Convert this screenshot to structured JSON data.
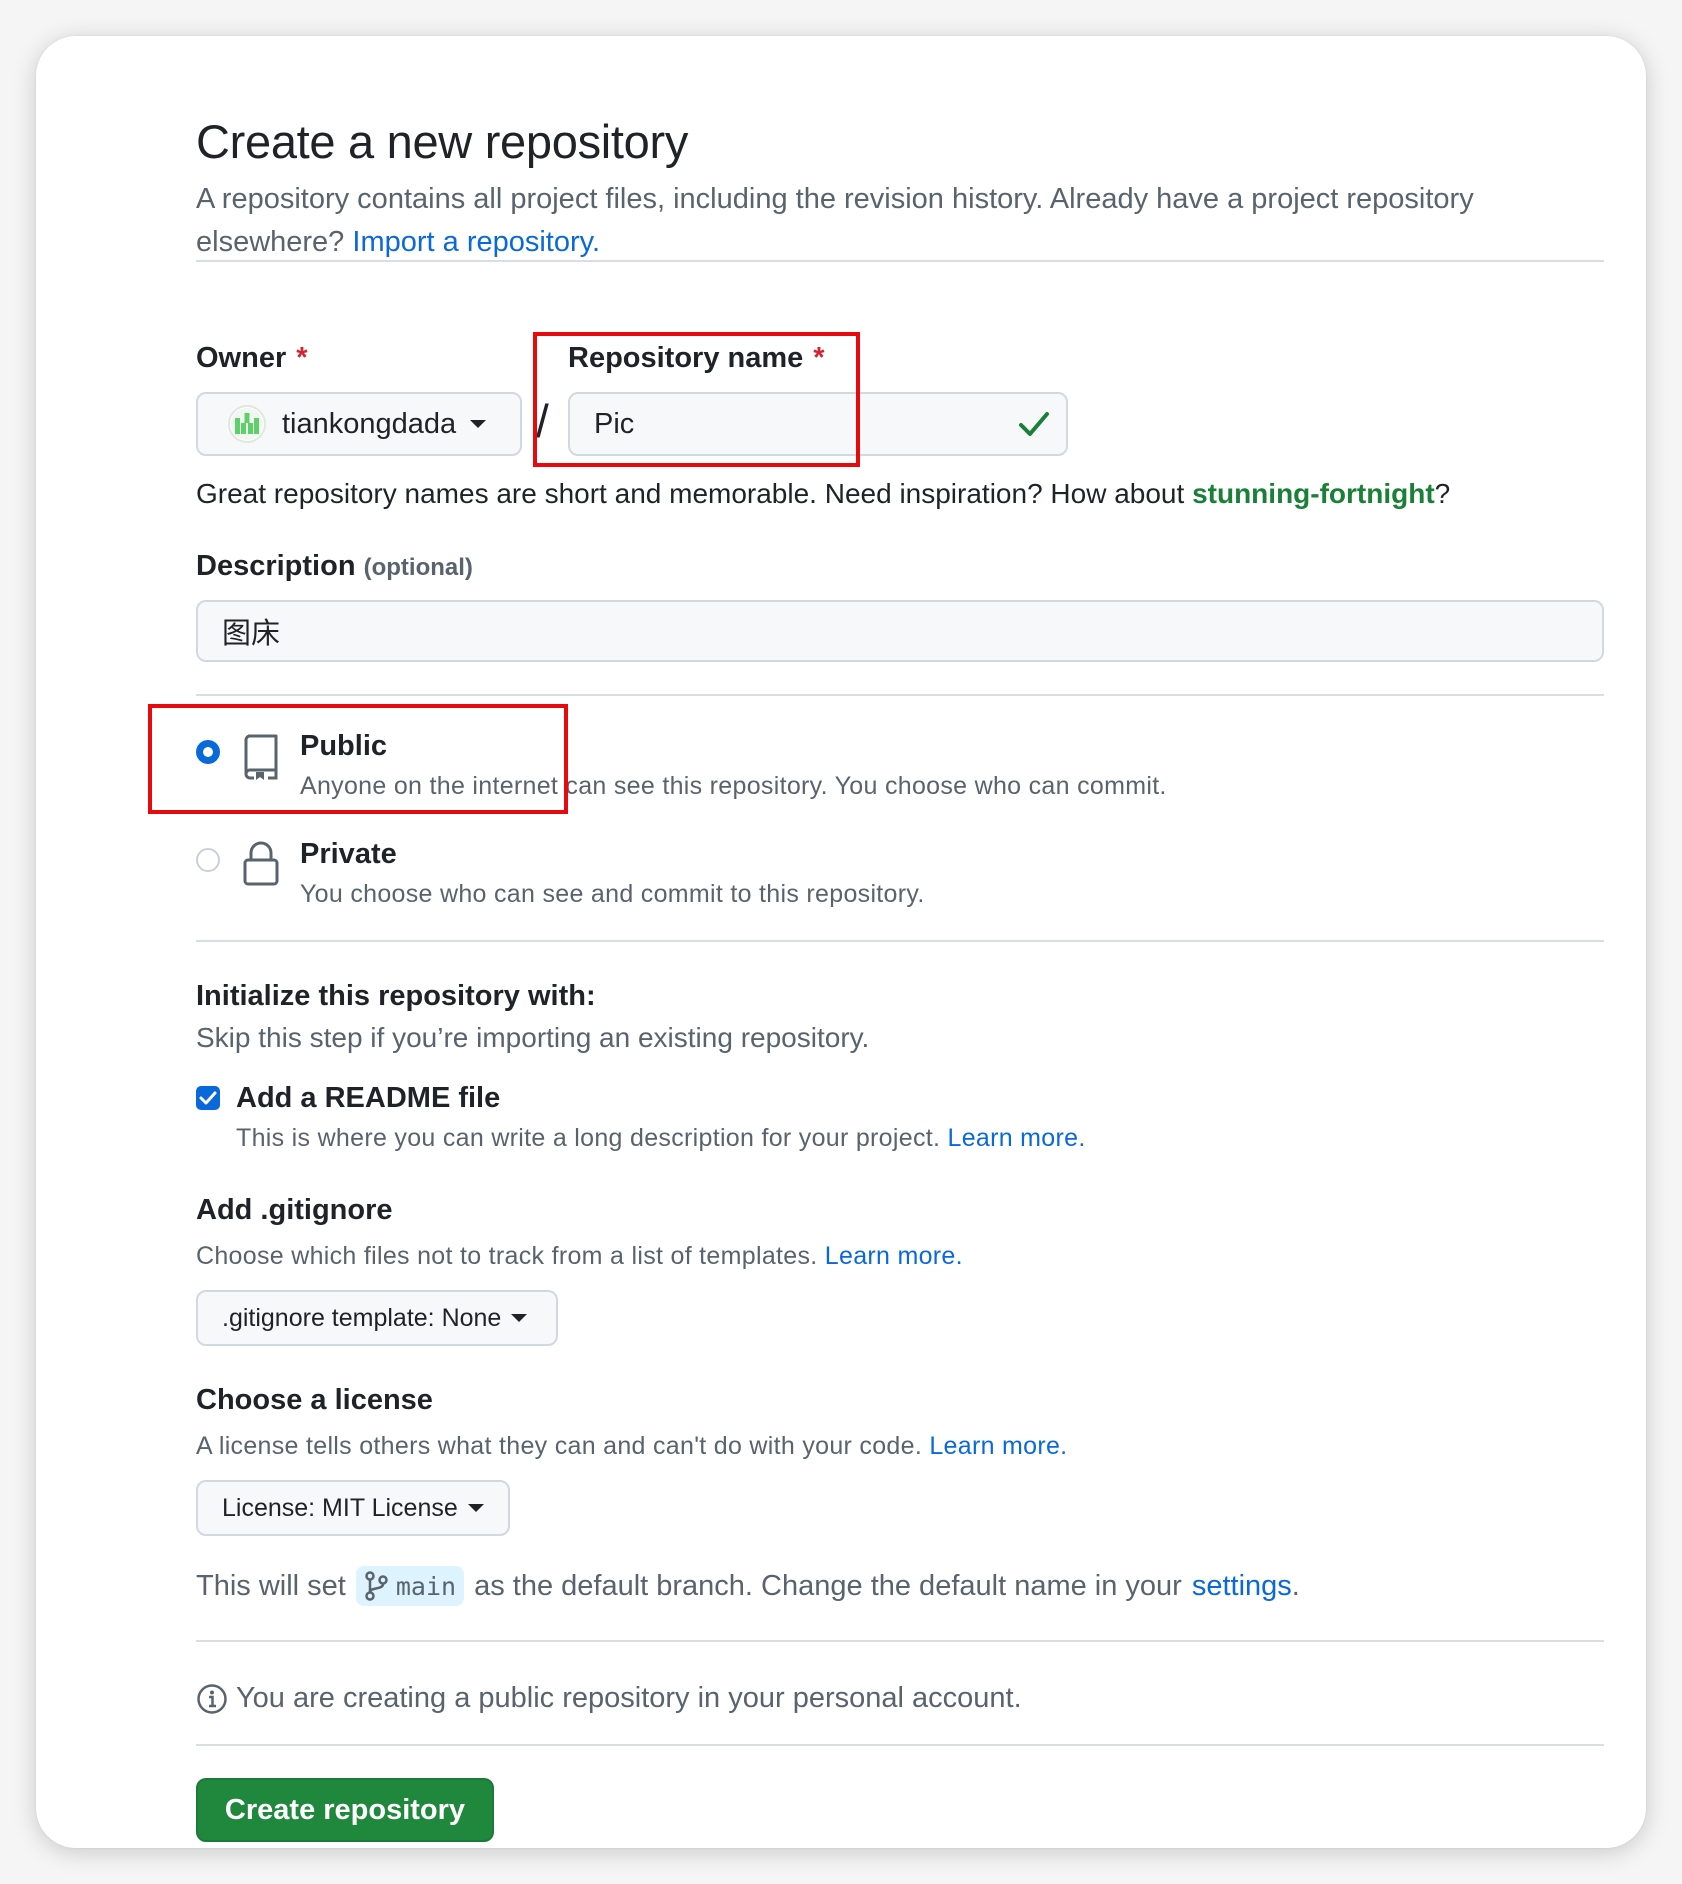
{
  "header": {
    "title": "Create a new repository",
    "description": "A repository contains all project files, including the revision history. Already have a project repository elsewhere?",
    "import_link": "Import a repository."
  },
  "owner": {
    "label": "Owner",
    "required_mark": "*",
    "value": "tiankongdada",
    "avatar_icon": "identicon-avatar"
  },
  "separator": "/",
  "repo_name": {
    "label": "Repository name",
    "required_mark": "*",
    "value": "Pic",
    "status_icon": "check-icon"
  },
  "name_hint": {
    "text": "Great repository names are short and memorable. Need inspiration? How about ",
    "suggestion": "stunning-fortnight",
    "suffix": "?"
  },
  "description": {
    "label": "Description",
    "optional": "(optional)",
    "value": "图床"
  },
  "visibility": {
    "options": [
      {
        "key": "public",
        "title": "Public",
        "desc": "Anyone on the internet can see this repository. You choose who can commit.",
        "selected": true,
        "icon": "repo-icon"
      },
      {
        "key": "private",
        "title": "Private",
        "desc": "You choose who can see and commit to this repository.",
        "selected": false,
        "icon": "lock-icon"
      }
    ]
  },
  "initialize": {
    "title": "Initialize this repository with:",
    "desc": "Skip this step if you’re importing an existing repository.",
    "readme": {
      "label": "Add a README file",
      "desc": "This is where you can write a long description for your project.",
      "learn_more": "Learn more.",
      "checked": true
    }
  },
  "gitignore": {
    "title": "Add .gitignore",
    "desc": "Choose which files not to track from a list of templates.",
    "learn_more": "Learn more.",
    "select_label": ".gitignore template: None"
  },
  "license": {
    "title": "Choose a license",
    "desc": "A license tells others what they can and can't do with your code.",
    "learn_more": "Learn more.",
    "select_label": "License: MIT License"
  },
  "branch": {
    "prefix": "This will set",
    "branch_name": "main",
    "middle": "as the default branch. Change the default name in your",
    "settings_link": "settings",
    "suffix": "."
  },
  "notice": {
    "text": "You are creating a public repository in your personal account.",
    "icon": "info-icon"
  },
  "submit": {
    "label": "Create repository"
  },
  "colors": {
    "accent": "#0969da",
    "success": "#1a7f37",
    "primary_button": "#1f883d",
    "required": "#d1242f",
    "annotation_box": "#e8090f"
  }
}
